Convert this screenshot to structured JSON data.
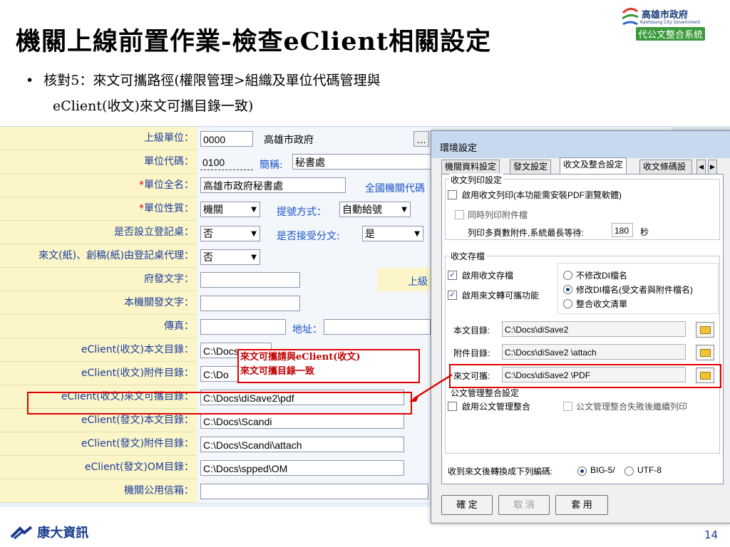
{
  "slide": {
    "title": "機關上線前置作業-檢查eClient相關設定",
    "bullet_line1": "核對5：來文可攜路徑(權限管理>組織及單位代碼管理與",
    "bullet_line2": "eClient(收文)來文可攜目錄一致)",
    "logo_line1": "高雄市政府",
    "logo_line2": "Kaohsiung City Government",
    "logo_line3": "代公文整合系統",
    "footer_brand": "康大資訊",
    "page_number": "14"
  },
  "form": {
    "rows": [
      {
        "label": "上級單位：",
        "value": "0000",
        "extra": "高雄市政府"
      },
      {
        "label": "單位代碼：",
        "value": "0100",
        "abbr_label": "簡稱:",
        "abbr_value": "秘書處"
      },
      {
        "label": "單位全名：",
        "required": "*",
        "value": "高雄市政府秘書處",
        "extra_link": "全國機關代碼"
      },
      {
        "label": "單位性質：",
        "required": "*",
        "value": "機關",
        "extra_label": "提號方式：",
        "extra_value": "自動給號"
      },
      {
        "label": "是否設立登記桌：",
        "value": "否",
        "extra_label": "是否接受分文:",
        "extra_value": "是"
      },
      {
        "label": "來文(紙)、創稿(紙)由登記桌代理：",
        "value": "否"
      },
      {
        "label": "府發文字：",
        "value": "",
        "extra": "上級"
      },
      {
        "label": "本機關發文字：",
        "value": ""
      },
      {
        "label": "傳真：",
        "value": "",
        "extra": "地址："
      },
      {
        "label": "eClient(收文)本文目錄：",
        "value": "C:\\Docs"
      },
      {
        "label": "eClient(收文)附件目錄：",
        "value": "C:\\Do"
      },
      {
        "label": "eClient(收文)來文可攜目錄：",
        "value": "C:\\Docs\\diSave2\\pdf"
      },
      {
        "label": "eClient(發文)本文目錄：",
        "value": "C:\\Docs\\Scandi"
      },
      {
        "label": "eClient(發文)附件目錄：",
        "value": "C:\\Docs\\Scandi\\attach"
      },
      {
        "label": "eClient(發文)OM目錄：",
        "value": "C:\\Docs\\spped\\OM"
      },
      {
        "label": "機關公用信箱：",
        "value": ""
      }
    ]
  },
  "annotation": {
    "line1": "來文可攜請與eClient(收文)",
    "line2": "來文可攜目錄一致"
  },
  "dialog": {
    "title": "環境設定",
    "tabs": [
      "機關資料設定",
      "發文設定",
      "收文及整合設定",
      "收文條碼設"
    ],
    "active_tab": 2,
    "print_group": "收文列印設定",
    "print_enable": "啟用收文列印(本功能需安裝PDF瀏覽軟體)",
    "print_attach": "同時列印附件檔",
    "print_wait": "列印多頁數附件,系統最長等待:",
    "print_wait_value": "180",
    "print_wait_unit": "秒",
    "archive_group": "收文存檔",
    "archive_enable": "啟用收文存檔",
    "archive_portable": "啟用來文轉可攜功能",
    "radio_options": [
      "不修改DI檔名",
      "修改DI檔名(受文者與附件檔名)",
      "整合收文清單"
    ],
    "radio_selected": 1,
    "main_dir_label": "本文目錄:",
    "main_dir_value": "C:\\Docs\\diSave2",
    "attach_dir_label": "附件目錄:",
    "attach_dir_value": "C:\\Docs\\diSave2 \\attach",
    "portable_dir_label": "來文可攜:",
    "portable_dir_value": "C:\\Docs\\diSave2 \\PDF",
    "official_group": "公文管理整合設定",
    "official_enable": "啟用公文管理整合",
    "official_continue": "公文管理整合失敗後繼續列印",
    "encoding_label": "收到來文後轉換成下列編碼:",
    "encoding_options": [
      "BIG-5/",
      "UTF-8"
    ],
    "encoding_selected": 0,
    "btn_ok": "確 定",
    "btn_cancel": "取 消",
    "btn_apply": "套 用"
  }
}
